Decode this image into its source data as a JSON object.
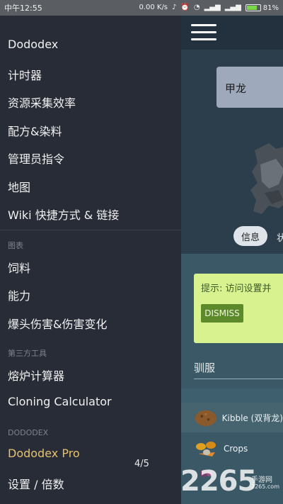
{
  "status_bar": {
    "time": "中午12:55",
    "speed": "0.00 K/s",
    "battery_percent": "81%",
    "battery_level": 0.81
  },
  "background_app": {
    "creature_name": "甲龙",
    "tabs": [
      "信息",
      "状"
    ],
    "hint_text": "提示: 访问设置并",
    "dismiss_label": "DISMISS",
    "tame_title": "驯服",
    "food_items": [
      {
        "label": "Kibble (双背龙)",
        "icon": "kibble-icon"
      },
      {
        "label": "Crops",
        "icon": "crops-icon"
      },
      {
        "label": "",
        "icon": "berry-icon"
      }
    ]
  },
  "drawer": {
    "items": [
      {
        "label": "Dododex"
      },
      {
        "label": "计时器"
      },
      {
        "label": "资源采集效率"
      },
      {
        "label": "配方&染料"
      },
      {
        "label": "管理员指令"
      },
      {
        "label": "地图"
      },
      {
        "label": "Wiki 快捷方式 & 链接"
      }
    ],
    "charts_header": "图表",
    "chart_items": [
      {
        "label": "饲料"
      },
      {
        "label": "能力"
      },
      {
        "label": "爆头伤害&伤害变化"
      }
    ],
    "third_party_header": "第三方工具",
    "third_party_items": [
      {
        "label": "熔炉计算器"
      },
      {
        "label": "Cloning Calculator"
      }
    ],
    "dododex_header": "DODODEX",
    "dododex_items": [
      {
        "label": "Dododex Pro"
      },
      {
        "label": "设置 / 倍数"
      }
    ]
  },
  "page_indicator": "4/5",
  "watermark": {
    "number": "2265",
    "sub": "手游网",
    "url": "2265.com"
  },
  "colors": {
    "drawer_bg": "#272c36",
    "pro_accent": "#e6c26e",
    "hint_bg": "#d7f28f",
    "dismiss_bg": "#5c8a2a"
  }
}
